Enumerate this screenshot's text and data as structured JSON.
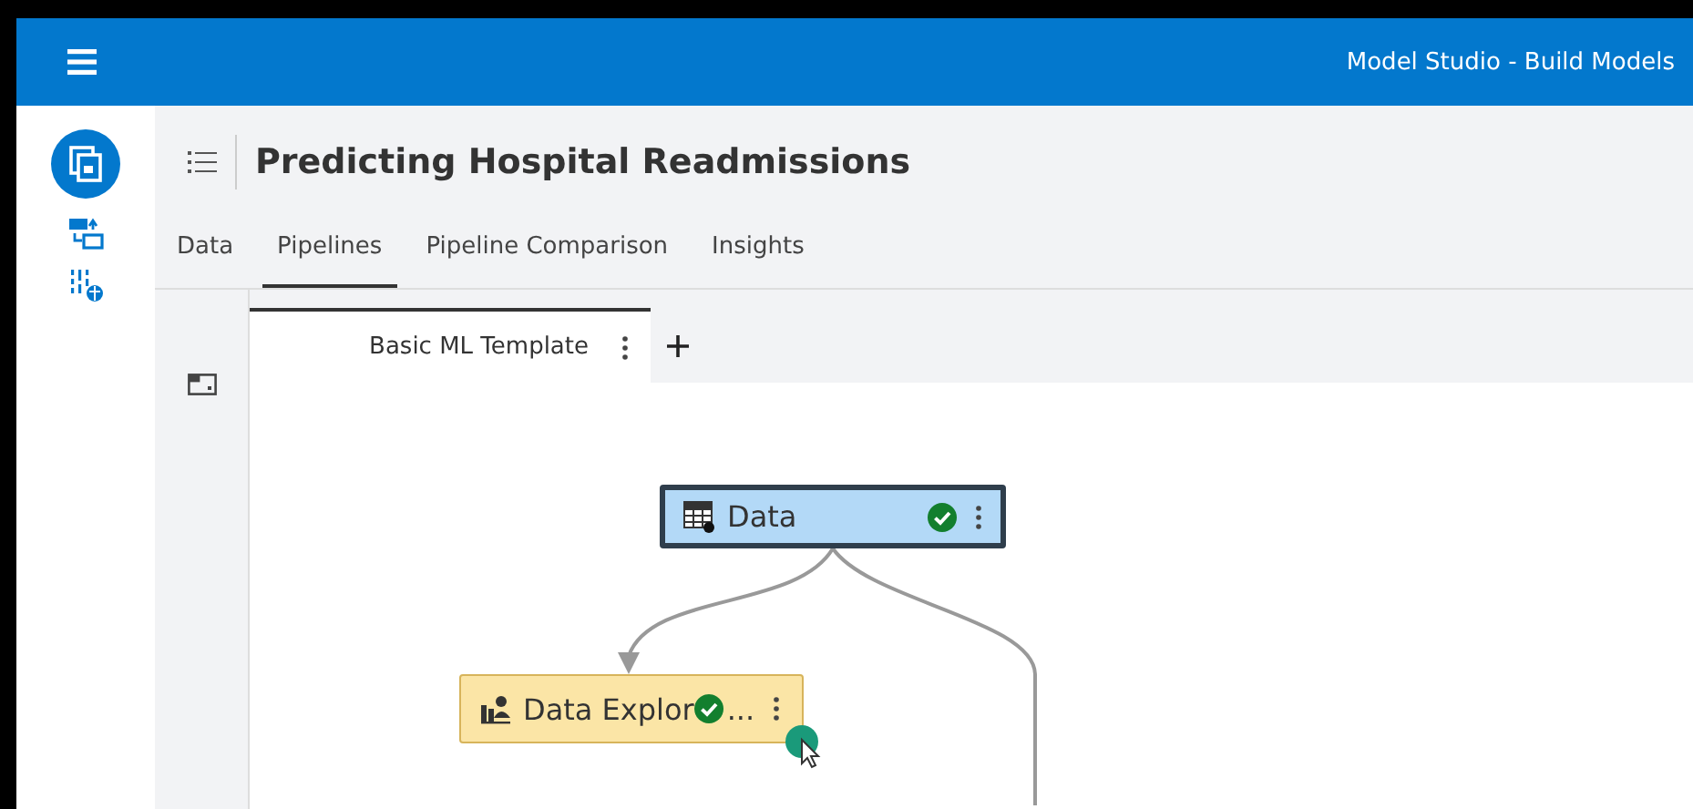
{
  "app_bar": {
    "title": "Model Studio - Build Models"
  },
  "project": {
    "title": "Predicting Hospital Readmissions"
  },
  "tabs": [
    {
      "label": "Data",
      "selected": false
    },
    {
      "label": "Pipelines",
      "selected": true
    },
    {
      "label": "Pipeline Comparison",
      "selected": false
    },
    {
      "label": "Insights",
      "selected": false
    }
  ],
  "pipeline_tabs": [
    {
      "label": "Basic ML Template",
      "selected": true
    }
  ],
  "nodes": [
    {
      "kind": "data",
      "label": "Data",
      "selected": true,
      "completed": true,
      "color": "#b3d9f7"
    },
    {
      "kind": "explore",
      "label": "Data Explor",
      "ellipsis": "...",
      "selected": false,
      "completed": true,
      "color": "#fbe5a6"
    }
  ]
}
